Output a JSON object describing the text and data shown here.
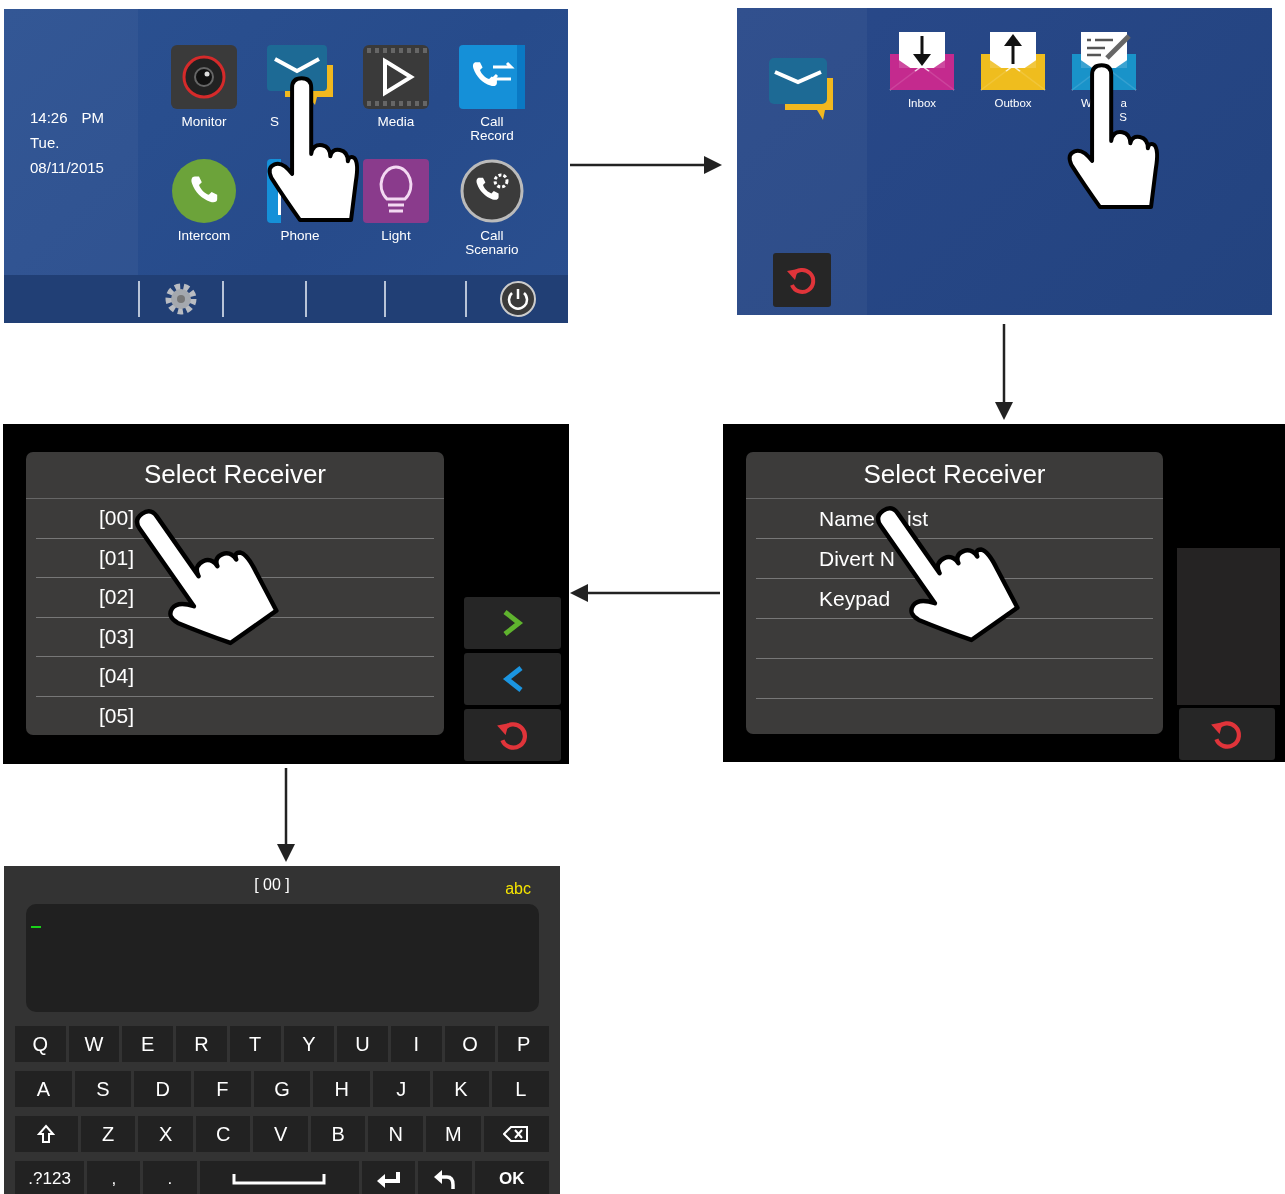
{
  "home_screen": {
    "time": "14:26",
    "meridiem": "PM",
    "day": "Tue.",
    "date": "08/11/2015",
    "apps": [
      {
        "kind": "camera",
        "label": "Monitor"
      },
      {
        "kind": "message",
        "label": "S"
      },
      {
        "kind": "media",
        "label": "Media"
      },
      {
        "kind": "call-record",
        "label": "Call Record"
      },
      {
        "kind": "intercom",
        "label": "Intercom"
      },
      {
        "kind": "phone",
        "label": "Phone"
      },
      {
        "kind": "light",
        "label": "Light"
      },
      {
        "kind": "call-scenario",
        "label": "Call Scenario"
      }
    ],
    "dock": [
      {
        "kind": "settings"
      },
      {
        "kind": "power"
      }
    ]
  },
  "message_screen": {
    "apps": [
      {
        "kind": "inbox",
        "label_lines": [
          [
            "Inbox"
          ]
        ]
      },
      {
        "kind": "outbox",
        "label_lines": [
          [
            "Outbox"
          ]
        ]
      },
      {
        "kind": "write",
        "label_lines": [
          [
            "W",
            "a"
          ],
          [
            "S"
          ]
        ]
      }
    ]
  },
  "receiver_menu": {
    "title": "Select Receiver",
    "options": [
      {
        "parts": [
          "Name",
          "ist"
        ]
      },
      {
        "parts": [
          "Divert N"
        ]
      },
      {
        "parts": [
          "Keypad"
        ]
      }
    ]
  },
  "receiver_list": {
    "title": "Select Receiver",
    "entries": [
      "[00]",
      "[01]",
      "[02]",
      "[03]",
      "[04]",
      "[05]"
    ],
    "buttons": [
      {
        "kind": "next"
      },
      {
        "kind": "previous"
      },
      {
        "kind": "back"
      }
    ]
  },
  "keyboard": {
    "title": "[ 00 ]",
    "mode": "abc",
    "key_rows": [
      [
        {
          "label": "Q"
        },
        {
          "label": "W"
        },
        {
          "label": "E"
        },
        {
          "label": "R"
        },
        {
          "label": "T"
        },
        {
          "label": "Y"
        },
        {
          "label": "U"
        },
        {
          "label": "I"
        },
        {
          "label": "O"
        },
        {
          "label": "P"
        }
      ],
      [
        {
          "label": "A"
        },
        {
          "label": "S"
        },
        {
          "label": "D"
        },
        {
          "label": "F"
        },
        {
          "label": "G"
        },
        {
          "label": "H"
        },
        {
          "label": "J"
        },
        {
          "label": "K"
        },
        {
          "label": "L"
        }
      ],
      [
        {
          "kind": "shift"
        },
        {
          "label": "Z"
        },
        {
          "label": "X"
        },
        {
          "label": "C"
        },
        {
          "label": "V"
        },
        {
          "label": "B"
        },
        {
          "label": "N"
        },
        {
          "label": "M"
        },
        {
          "kind": "backspace"
        }
      ],
      [
        {
          "kind": "symbols",
          "label": ".?123"
        },
        {
          "label": ","
        },
        {
          "label": "."
        },
        {
          "kind": "space"
        },
        {
          "kind": "enter"
        },
        {
          "kind": "undo"
        },
        {
          "kind": "ok",
          "label": "OK"
        }
      ]
    ]
  }
}
